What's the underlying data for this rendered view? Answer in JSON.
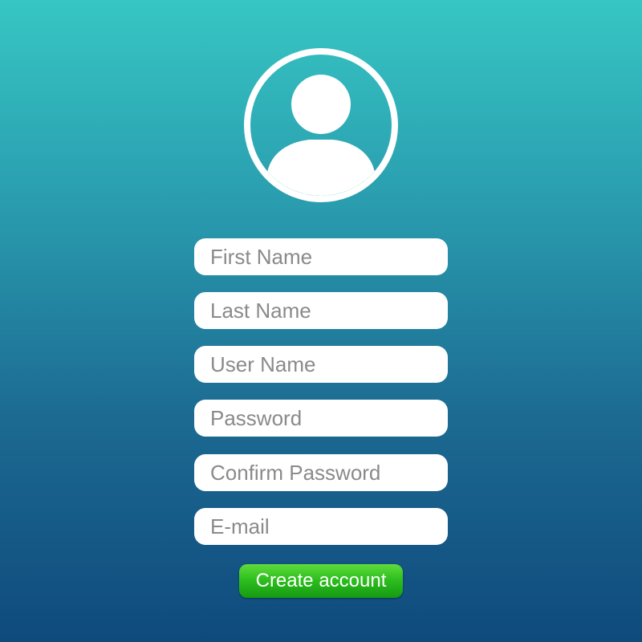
{
  "avatar": {
    "icon": "user-avatar-icon"
  },
  "form": {
    "fields": [
      {
        "placeholder": "First Name"
      },
      {
        "placeholder": "Last Name"
      },
      {
        "placeholder": "User Name"
      },
      {
        "placeholder": "Password"
      },
      {
        "placeholder": "Confirm Password"
      },
      {
        "placeholder": "E-mail"
      }
    ],
    "submit_label": "Create account"
  },
  "colors": {
    "background_top": "#37c6c3",
    "background_bottom": "#0f4a7d",
    "field_bg": "#ffffff",
    "placeholder_text": "#8a8a8a",
    "button_green": "#2fbf1f"
  }
}
